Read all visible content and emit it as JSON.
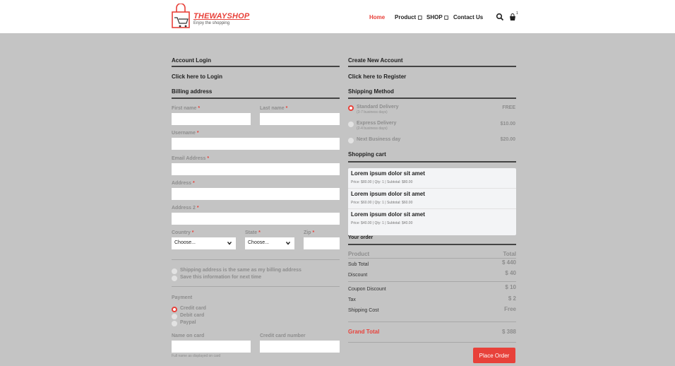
{
  "header": {
    "brand": "THEWAYSHOP",
    "tagline": "Enjoy the shopping",
    "nav": [
      "Home",
      "Product ◻",
      "SHOP ◻",
      "Contact Us"
    ],
    "cart_count": "1"
  },
  "left": {
    "account_login": "Account Login",
    "click_login": "Click here to Login",
    "billing_address": "Billing address",
    "first_name": "First name",
    "last_name": "Last name",
    "username": "Username",
    "email": "Email Address",
    "address": "Address",
    "address2": "Address 2",
    "country": "Country",
    "state": "State",
    "zip": "Zip",
    "required_mark": "*",
    "country_value": "Choose...",
    "state_value": "Choose...",
    "same_address": "Shipping address is the same as my billing address",
    "save_info": "Save this information for next time",
    "payment": "Payment",
    "payment_options": [
      "Credit card",
      "Debit card",
      "Paypal"
    ],
    "name_on_card": "Name on card",
    "card_number": "Credit card number",
    "name_hint": "Full name as displayed on card"
  },
  "right": {
    "create_account": "Create New Account",
    "click_register": "Click here to Register",
    "shipping_method": "Shipping Method",
    "shipping": [
      {
        "name": "Standard Delivery",
        "sub": "(3-7 business days)",
        "price": "FREE"
      },
      {
        "name": "Express Delivery",
        "sub": "(2-4 business days)",
        "price": "$10.00"
      },
      {
        "name": "Next Business day",
        "sub": "",
        "price": "$20.00"
      }
    ],
    "shopping_cart": "Shopping cart",
    "cart_items": [
      {
        "title": "Lorem ipsum dolor sit amet",
        "meta": "Price: $80.00  |  Qty: 1  |  Subtotal: $80.00"
      },
      {
        "title": "Lorem ipsum dolor sit amet",
        "meta": "Price: $60.00  |  Qty: 1  |  Subtotal: $60.00"
      },
      {
        "title": "Lorem ipsum dolor sit amet",
        "meta": "Price: $40.00  |  Qty: 1  |  Subtotal: $40.00"
      }
    ],
    "your_order": "Your order",
    "order": {
      "product": "Product",
      "total": "Total",
      "sub_total": "Sub Total",
      "sub_total_value": "$ 440",
      "discount": "Discount",
      "discount_value": "$ 40",
      "coupon": "Coupon Discount",
      "coupon_value": "$ 10",
      "tax": "Tax",
      "tax_value": "$ 2",
      "shipping_cost": "Shipping Cost",
      "shipping_value": "Free",
      "grand_total": "Grand Total",
      "grand_total_value": "$ 388"
    },
    "place_order": "Place Order"
  },
  "colors": {
    "accent": "#e8413a",
    "background": "#c4c4c4"
  }
}
